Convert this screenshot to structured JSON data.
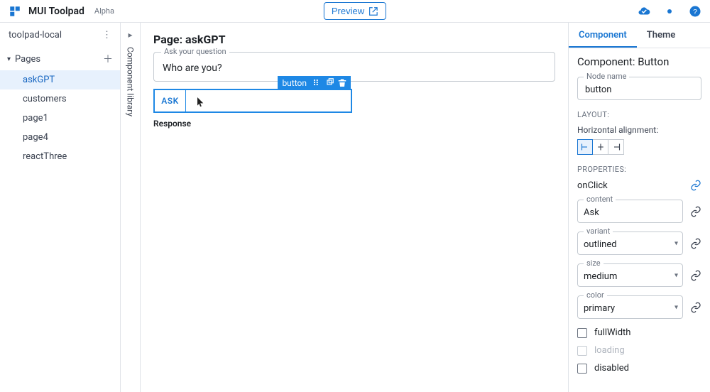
{
  "brand": "MUI Toolpad",
  "tag": "Alpha",
  "preview_label": "Preview",
  "project_name": "toolpad-local",
  "pages_label": "Pages",
  "pages": [
    {
      "name": "askGPT",
      "active": true
    },
    {
      "name": "customers",
      "active": false
    },
    {
      "name": "page1",
      "active": false
    },
    {
      "name": "page4",
      "active": false
    },
    {
      "name": "reactThree",
      "active": false
    }
  ],
  "component_library_label": "Component library",
  "page_heading": "Page: askGPT",
  "question_field": {
    "label": "Ask your question",
    "value": "Who are you?"
  },
  "selected_tooltip": "button",
  "ask_button_label": "ASK",
  "response_heading": "Response",
  "tabs": {
    "component": "Component",
    "theme": "Theme"
  },
  "inspector": {
    "title": "Component: Button",
    "node_name_label": "Node name",
    "node_name_value": "button",
    "layout_label": "LAYOUT:",
    "halign_label": "Horizontal alignment:",
    "halign": "start",
    "properties_label": "PROPERTIES:",
    "onClick_label": "onClick",
    "content_label": "content",
    "content_value": "Ask",
    "variant_label": "variant",
    "variant_value": "outlined",
    "size_label": "size",
    "size_value": "medium",
    "color_label": "color",
    "color_value": "primary",
    "fullWidth_label": "fullWidth",
    "loading_label": "loading",
    "disabled_label": "disabled"
  },
  "colors": {
    "primary": "#1976d2",
    "selection": "#1e88e5"
  }
}
